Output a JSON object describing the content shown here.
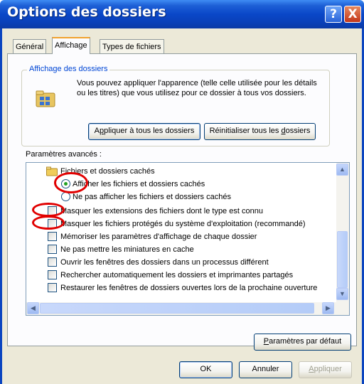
{
  "window": {
    "title": "Options des dossiers",
    "help_glyph": "?",
    "close_glyph": "X"
  },
  "tabs": [
    {
      "label": "Général",
      "active": false
    },
    {
      "label": "Affichage",
      "active": true
    },
    {
      "label": "Types de fichiers",
      "active": false
    }
  ],
  "folder_view": {
    "group_label": "Affichage des dossiers",
    "description": "Vous pouvez appliquer l'apparence (telle celle utilisée pour les détails ou les titres) que vous utilisez pour ce dossier à tous vos dossiers.",
    "apply_all": {
      "pre": "A",
      "u": "p",
      "post": "pliquer à tous les dossiers"
    },
    "reset_all": {
      "pre": "Réinitialiser tous les ",
      "u": "d",
      "post": "ossiers"
    }
  },
  "advanced": {
    "label": "Paramètres avancés :",
    "items": [
      {
        "type": "folder",
        "label": "Fichiers et dossiers cachés"
      },
      {
        "type": "radio",
        "checked": true,
        "label": "Afficher les fichiers et dossiers cachés"
      },
      {
        "type": "radio",
        "checked": false,
        "label": "Ne pas afficher les fichiers et dossiers cachés"
      },
      {
        "type": "checkbox",
        "checked": false,
        "label": "Masquer les extensions des fichiers dont le type est connu"
      },
      {
        "type": "checkbox",
        "checked": false,
        "label": "Masquer les fichiers protégés du système d'exploitation (recommandé)"
      },
      {
        "type": "checkbox",
        "checked": false,
        "label": "Mémoriser les paramètres d'affichage de chaque dossier"
      },
      {
        "type": "checkbox",
        "checked": false,
        "label": "Ne pas mettre les miniatures en cache"
      },
      {
        "type": "checkbox",
        "checked": false,
        "label": "Ouvrir les fenêtres des dossiers dans un processus différent"
      },
      {
        "type": "checkbox",
        "checked": false,
        "label": "Rechercher automatiquement les dossiers et imprimantes partagés"
      },
      {
        "type": "checkbox",
        "checked": false,
        "label": "Restaurer les fenêtres de dossiers ouvertes lors de la prochaine ouverture"
      }
    ],
    "default_button": {
      "pre": "",
      "u": "P",
      "post": "aramètres par défaut"
    }
  },
  "footer": {
    "ok": "OK",
    "cancel": "Annuler",
    "apply": {
      "pre": "",
      "u": "A",
      "post": "ppliquer"
    }
  }
}
